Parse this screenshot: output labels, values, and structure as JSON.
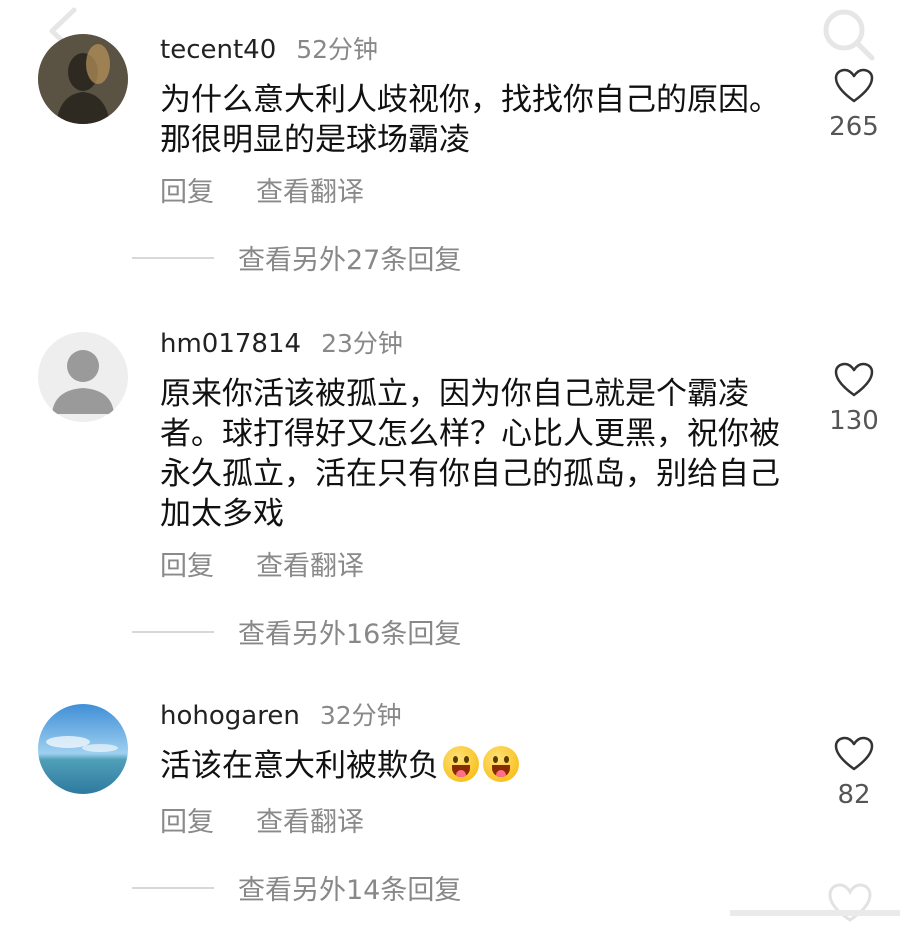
{
  "comments": [
    {
      "username": "tecent40",
      "time": "52分钟",
      "text": "为什么意大利人歧视你，找找你自己的原因。那很明显的是球场霸凌",
      "reply_label": "回复",
      "translate_label": "查看翻译",
      "likes": "265",
      "view_replies": "查看另外27条回复"
    },
    {
      "username": "hm017814",
      "time": "23分钟",
      "text": "原来你活该被孤立，因为你自己就是个霸凌者。球打得好又怎么样？心比人更黑，祝你被永久孤立，活在只有你自己的孤岛，别给自己加太多戏",
      "reply_label": "回复",
      "translate_label": "查看翻译",
      "likes": "130",
      "view_replies": "查看另外16条回复"
    },
    {
      "username": "hohogaren",
      "time": "32分钟",
      "text": "活该在意大利被欺负",
      "reply_label": "回复",
      "translate_label": "查看翻译",
      "likes": "82",
      "view_replies": "查看另外14条回复"
    }
  ],
  "icons": {
    "back": "chevron-left-icon",
    "search": "search-icon",
    "like": "heart-outline-icon",
    "emoji": "tongue-out-face-emoji"
  },
  "colors": {
    "text": "#111111",
    "secondary": "#888888"
  }
}
